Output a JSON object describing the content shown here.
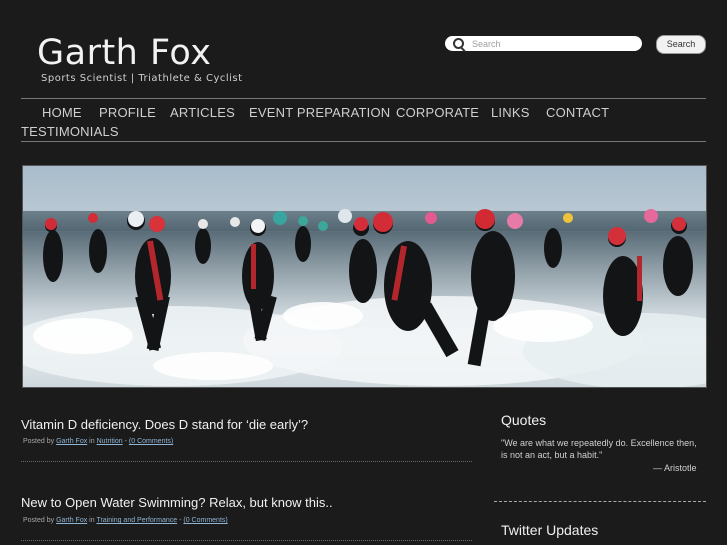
{
  "site": {
    "title": "Garth Fox",
    "tagline": "Sports Scientist | Triathlete & Cyclist"
  },
  "search": {
    "placeholder": "Search",
    "button_label": "Search",
    "icon": "search-icon"
  },
  "nav": {
    "items": [
      {
        "label": "HOME"
      },
      {
        "label": "PROFILE"
      },
      {
        "label": "ARTICLES"
      },
      {
        "label": "EVENT PREPARATION"
      },
      {
        "label": "CORPORATE"
      },
      {
        "label": "LINKS"
      },
      {
        "label": "CONTACT"
      },
      {
        "label": "TESTIMONIALS"
      }
    ]
  },
  "posts": [
    {
      "title": "Vitamin D deficiency. Does D stand for ‘die early’?",
      "posted_by": "Posted by",
      "author": "Garth Fox",
      "in": "in",
      "category": "Nutrition",
      "sep": "-",
      "comments": "(0 Comments)"
    },
    {
      "title": "New to Open Water Swimming? Relax, but know this..",
      "posted_by": "Posted by",
      "author": "Garth Fox",
      "in": "in",
      "category": "Training and Performance",
      "sep": "-",
      "comments": "(0 Comments)"
    }
  ],
  "sidebar": {
    "quotes_heading": "Quotes",
    "quote": "\"We are what we repeatedly do. Excellence then, is not an act, but a habit.\"",
    "quote_author": "— Aristotle",
    "twitter_heading": "Twitter Updates"
  },
  "colors": {
    "background": "#1b1b1b",
    "link": "#8fb4d4",
    "text": "#d8d8d8"
  }
}
